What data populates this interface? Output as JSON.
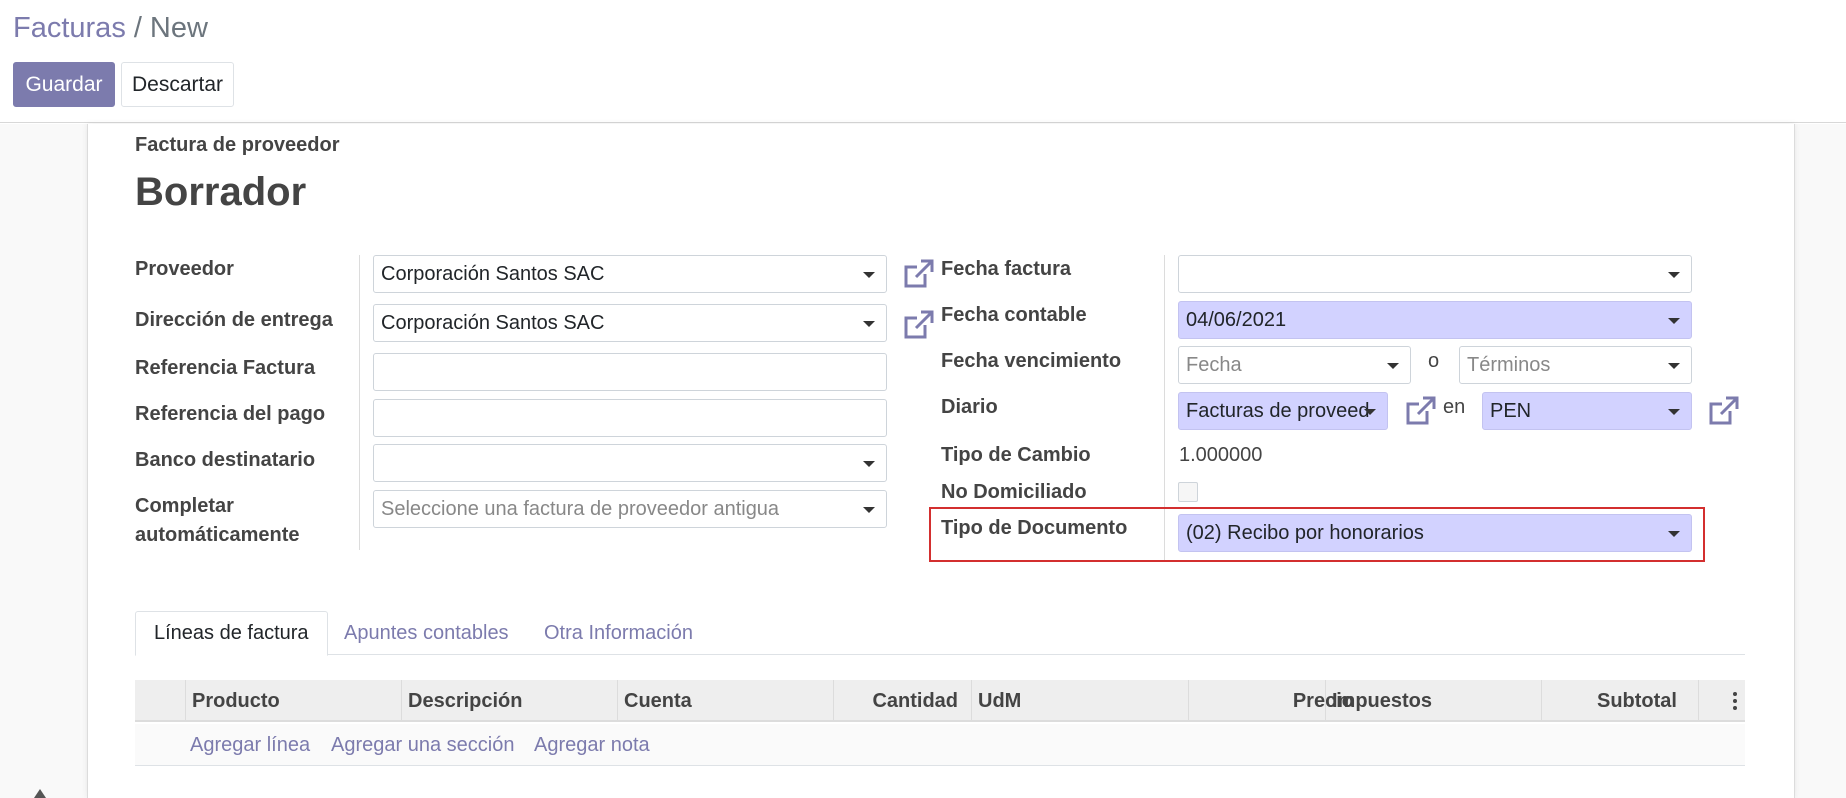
{
  "breadcrumb": {
    "parent": "Facturas",
    "separator": "/",
    "current": "New"
  },
  "buttons": {
    "save": "Guardar",
    "discard": "Descartar"
  },
  "form": {
    "subtitle": "Factura de proveedor",
    "state": "Borrador",
    "left": {
      "proveedor": {
        "label": "Proveedor",
        "value": "Corporación Santos SAC"
      },
      "direccion": {
        "label": "Dirección de entrega",
        "value": "Corporación Santos SAC"
      },
      "ref_factura": {
        "label": "Referencia Factura",
        "value": ""
      },
      "ref_pago": {
        "label": "Referencia del pago",
        "value": ""
      },
      "banco": {
        "label": "Banco destinatario",
        "value": ""
      },
      "completar": {
        "label_line1": "Completar",
        "label_line2": "automáticamente",
        "placeholder": "Seleccione una factura de proveedor antigua"
      }
    },
    "right": {
      "fecha_factura": {
        "label": "Fecha factura",
        "value": ""
      },
      "fecha_contable": {
        "label": "Fecha contable",
        "value": "04/06/2021"
      },
      "fecha_vencimiento": {
        "label": "Fecha vencimiento",
        "date_placeholder": "Fecha",
        "or": "o",
        "terms_placeholder": "Términos"
      },
      "diario": {
        "label": "Diario",
        "value": "Facturas de proveed",
        "in": "en",
        "currency": "PEN"
      },
      "tipo_cambio": {
        "label": "Tipo de Cambio",
        "value": "1.000000"
      },
      "no_domiciliado": {
        "label": "No Domiciliado",
        "checked": false
      },
      "tipo_documento": {
        "label": "Tipo de Documento",
        "value": "(02) Recibo por honorarios"
      }
    }
  },
  "tabs": [
    {
      "label": "Líneas de factura",
      "active": true
    },
    {
      "label": "Apuntes contables",
      "active": false
    },
    {
      "label": "Otra Información",
      "active": false
    }
  ],
  "table": {
    "columns": [
      "Producto",
      "Descripción",
      "Cuenta",
      "Cantidad",
      "UdM",
      "Precio",
      "Impuestos",
      "Subtotal"
    ],
    "add_line": "Agregar línea",
    "add_section": "Agregar una sección",
    "add_note": "Agregar nota"
  },
  "colors": {
    "primary": "#7c7bad",
    "required_bg": "#d2d2ff",
    "highlight": "#d32f2f"
  },
  "icons": {
    "external_link": "external-link-icon",
    "dropdown": "caret-down-icon",
    "options": "kebab-icon"
  }
}
